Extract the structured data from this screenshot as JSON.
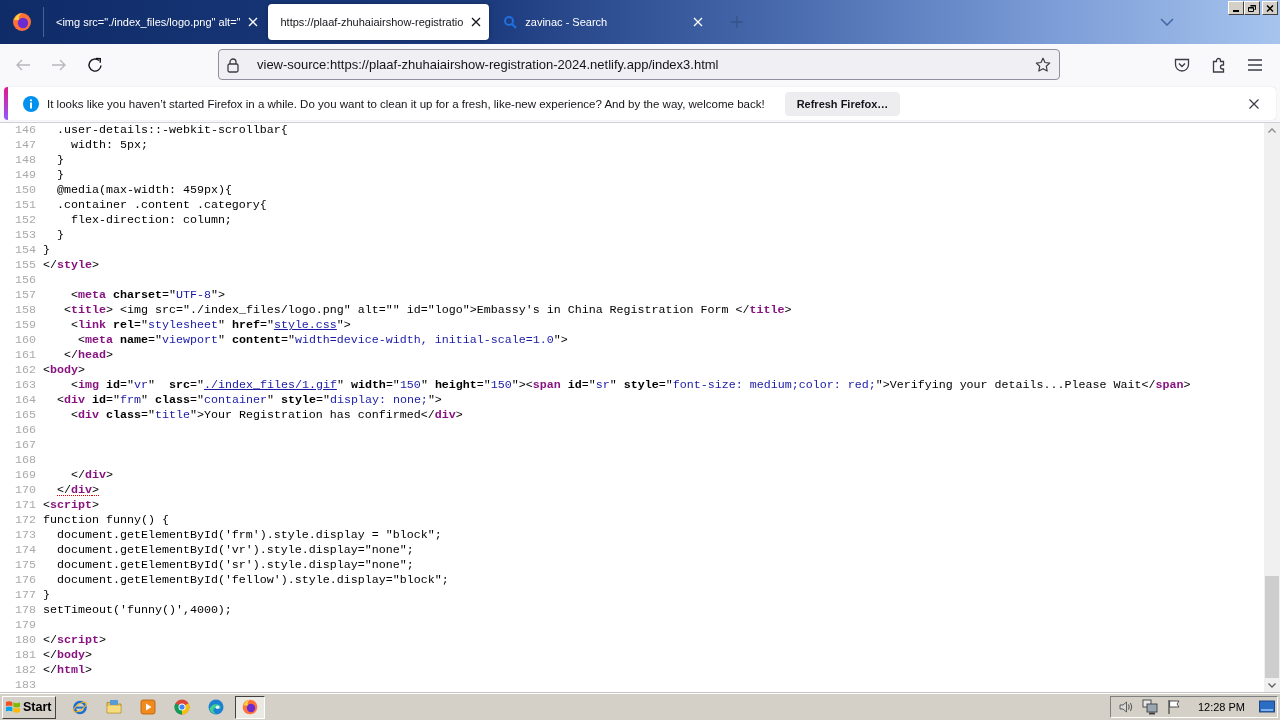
{
  "browser": {
    "tabs": [
      {
        "title": "<img src=\"./index_files/logo.png\" alt=\"",
        "kind": "plain",
        "selected": false
      },
      {
        "title": "https://plaaf-zhuhaiairshow-registratio",
        "kind": "plain",
        "selected": true
      },
      {
        "title": "zavinac - Search",
        "kind": "search",
        "selected": false
      }
    ],
    "nav_buttons": [
      {
        "kind": "back",
        "disabled": true
      },
      {
        "kind": "forward",
        "disabled": true
      },
      {
        "kind": "reload",
        "disabled": false
      }
    ],
    "address_bar": {
      "value": "view-source:https://plaaf-zhuhaiairshow-registration-2024.netlify.app/index3.html"
    },
    "notification": {
      "message": "It looks like you haven’t started Firefox in a while. Do you want to clean it up for a fresh, like-new experience? And by the way, welcome back!",
      "button": "Refresh Firefox…"
    }
  },
  "source": {
    "lines": [
      {
        "number": "146",
        "flagged": false,
        "tokens": [
          {
            "kind": "text",
            "text": "  .user-details::-webkit-scrollbar{"
          }
        ]
      },
      {
        "number": "147",
        "flagged": false,
        "tokens": [
          {
            "kind": "text",
            "text": "    width: 5px;"
          }
        ]
      },
      {
        "number": "148",
        "flagged": false,
        "tokens": [
          {
            "kind": "text",
            "text": "  }"
          }
        ]
      },
      {
        "number": "149",
        "flagged": false,
        "tokens": [
          {
            "kind": "text",
            "text": "  }"
          }
        ]
      },
      {
        "number": "150",
        "flagged": false,
        "tokens": [
          {
            "kind": "text",
            "text": "  @media(max-width: 459px){"
          }
        ]
      },
      {
        "number": "151",
        "flagged": false,
        "tokens": [
          {
            "kind": "text",
            "text": "  .container .content .category{"
          }
        ]
      },
      {
        "number": "152",
        "flagged": false,
        "tokens": [
          {
            "kind": "text",
            "text": "    flex-direction: column;"
          }
        ]
      },
      {
        "number": "153",
        "flagged": false,
        "tokens": [
          {
            "kind": "text",
            "text": "  }"
          }
        ]
      },
      {
        "number": "154",
        "flagged": false,
        "tokens": [
          {
            "kind": "text",
            "text": "}"
          }
        ]
      },
      {
        "number": "155",
        "flagged": false,
        "tokens": [
          {
            "kind": "text",
            "text": "</"
          },
          {
            "kind": "tag",
            "text": "style"
          },
          {
            "kind": "text",
            "text": ">"
          }
        ]
      },
      {
        "number": "156",
        "flagged": false
      },
      {
        "number": "157",
        "flagged": false,
        "tokens": [
          {
            "kind": "text",
            "text": "    <"
          },
          {
            "kind": "tag",
            "text": "meta"
          },
          {
            "kind": "attr",
            "text": " charset"
          },
          {
            "kind": "text",
            "text": "=\""
          },
          {
            "kind": "value",
            "text": "UTF-8"
          },
          {
            "kind": "text",
            "text": "\">"
          }
        ]
      },
      {
        "number": "158",
        "flagged": false,
        "tokens": [
          {
            "kind": "text",
            "text": "   <"
          },
          {
            "kind": "tag",
            "text": "title"
          },
          {
            "kind": "text",
            "text": "> <img src=\"./index_files/logo.png\" alt=\"\" id=\"logo\">Embassy's in China Registration Form </"
          },
          {
            "kind": "tag",
            "text": "title"
          },
          {
            "kind": "text",
            "text": ">"
          }
        ]
      },
      {
        "number": "159",
        "flagged": false,
        "tokens": [
          {
            "kind": "text",
            "text": "    <"
          },
          {
            "kind": "tag",
            "text": "link"
          },
          {
            "kind": "attr",
            "text": " rel"
          },
          {
            "kind": "text",
            "text": "=\""
          },
          {
            "kind": "value",
            "text": "stylesheet"
          },
          {
            "kind": "text",
            "text": "\" "
          },
          {
            "kind": "attr",
            "text": "href"
          },
          {
            "kind": "text",
            "text": "=\""
          },
          {
            "kind": "link",
            "text": "style.css"
          },
          {
            "kind": "text",
            "text": "\">"
          }
        ]
      },
      {
        "number": "160",
        "flagged": false,
        "tokens": [
          {
            "kind": "text",
            "text": "     <"
          },
          {
            "kind": "tag",
            "text": "meta"
          },
          {
            "kind": "attr",
            "text": " name"
          },
          {
            "kind": "text",
            "text": "=\""
          },
          {
            "kind": "value",
            "text": "viewport"
          },
          {
            "kind": "text",
            "text": "\" "
          },
          {
            "kind": "attr",
            "text": "content"
          },
          {
            "kind": "text",
            "text": "=\""
          },
          {
            "kind": "value",
            "text": "width=device-width, initial-scale=1.0"
          },
          {
            "kind": "text",
            "text": "\">"
          }
        ]
      },
      {
        "number": "161",
        "flagged": false,
        "tokens": [
          {
            "kind": "text",
            "text": "   </"
          },
          {
            "kind": "tag",
            "text": "head"
          },
          {
            "kind": "text",
            "text": ">"
          }
        ]
      },
      {
        "number": "162",
        "flagged": false,
        "tokens": [
          {
            "kind": "text",
            "text": "<"
          },
          {
            "kind": "tag",
            "text": "body"
          },
          {
            "kind": "text",
            "text": ">"
          }
        ]
      },
      {
        "number": "163",
        "flagged": false,
        "tokens": [
          {
            "kind": "text",
            "text": "    <"
          },
          {
            "kind": "tag",
            "text": "img"
          },
          {
            "kind": "attr",
            "text": " id"
          },
          {
            "kind": "text",
            "text": "=\""
          },
          {
            "kind": "value",
            "text": "vr"
          },
          {
            "kind": "text",
            "text": "\"  "
          },
          {
            "kind": "attr",
            "text": "src"
          },
          {
            "kind": "text",
            "text": "=\""
          },
          {
            "kind": "link",
            "text": "./index_files/1.gif"
          },
          {
            "kind": "text",
            "text": "\" "
          },
          {
            "kind": "attr",
            "text": "width"
          },
          {
            "kind": "text",
            "text": "=\""
          },
          {
            "kind": "value",
            "text": "150"
          },
          {
            "kind": "text",
            "text": "\" "
          },
          {
            "kind": "attr",
            "text": "height"
          },
          {
            "kind": "text",
            "text": "=\""
          },
          {
            "kind": "value",
            "text": "150"
          },
          {
            "kind": "text",
            "text": "\"><"
          },
          {
            "kind": "tag",
            "text": "span"
          },
          {
            "kind": "attr",
            "text": " id"
          },
          {
            "kind": "text",
            "text": "=\""
          },
          {
            "kind": "value",
            "text": "sr"
          },
          {
            "kind": "text",
            "text": "\" "
          },
          {
            "kind": "attr",
            "text": "style"
          },
          {
            "kind": "text",
            "text": "=\""
          },
          {
            "kind": "value",
            "text": "font-size: medium;color: red;"
          },
          {
            "kind": "text",
            "text": "\">Verifying your details...Please Wait</"
          },
          {
            "kind": "tag",
            "text": "span"
          },
          {
            "kind": "text",
            "text": ">"
          }
        ]
      },
      {
        "number": "164",
        "flagged": false,
        "tokens": [
          {
            "kind": "text",
            "text": "  <"
          },
          {
            "kind": "tag",
            "text": "div"
          },
          {
            "kind": "attr",
            "text": " id"
          },
          {
            "kind": "text",
            "text": "=\""
          },
          {
            "kind": "value",
            "text": "frm"
          },
          {
            "kind": "text",
            "text": "\" "
          },
          {
            "kind": "attr",
            "text": "class"
          },
          {
            "kind": "text",
            "text": "=\""
          },
          {
            "kind": "value",
            "text": "container"
          },
          {
            "kind": "text",
            "text": "\" "
          },
          {
            "kind": "attr",
            "text": "style"
          },
          {
            "kind": "text",
            "text": "=\""
          },
          {
            "kind": "value",
            "text": "display: none;"
          },
          {
            "kind": "text",
            "text": "\">"
          }
        ]
      },
      {
        "number": "165",
        "flagged": false,
        "tokens": [
          {
            "kind": "text",
            "text": "    <"
          },
          {
            "kind": "tag",
            "text": "div"
          },
          {
            "kind": "attr",
            "text": " class"
          },
          {
            "kind": "text",
            "text": "=\""
          },
          {
            "kind": "value",
            "text": "title"
          },
          {
            "kind": "text",
            "text": "\">Your Registration has confirmed</"
          },
          {
            "kind": "tag",
            "text": "div"
          },
          {
            "kind": "text",
            "text": ">"
          }
        ]
      },
      {
        "number": "166",
        "flagged": false
      },
      {
        "number": "167",
        "flagged": false
      },
      {
        "number": "168",
        "flagged": false
      },
      {
        "number": "169",
        "flagged": false,
        "tokens": [
          {
            "kind": "text",
            "text": "    </"
          },
          {
            "kind": "tag",
            "text": "div"
          },
          {
            "kind": "text",
            "text": ">"
          }
        ]
      },
      {
        "number": "170",
        "flagged": true,
        "tokens": [
          {
            "kind": "text",
            "text": "  </"
          },
          {
            "kind": "tag",
            "text": "div"
          },
          {
            "kind": "text",
            "text": ">"
          }
        ]
      },
      {
        "number": "171",
        "flagged": false,
        "tokens": [
          {
            "kind": "text",
            "text": "<"
          },
          {
            "kind": "tag",
            "text": "script"
          },
          {
            "kind": "text",
            "text": ">"
          }
        ]
      },
      {
        "number": "172",
        "flagged": false,
        "tokens": [
          {
            "kind": "text",
            "text": "function funny() {"
          }
        ]
      },
      {
        "number": "173",
        "flagged": false,
        "tokens": [
          {
            "kind": "text",
            "text": "  document.getElementById('frm').style.display = \"block\";"
          }
        ]
      },
      {
        "number": "174",
        "flagged": false,
        "tokens": [
          {
            "kind": "text",
            "text": "  document.getElementById('vr').style.display=\"none\";"
          }
        ]
      },
      {
        "number": "175",
        "flagged": false,
        "tokens": [
          {
            "kind": "text",
            "text": "  document.getElementById('sr').style.display=\"none\";"
          }
        ]
      },
      {
        "number": "176",
        "flagged": false,
        "tokens": [
          {
            "kind": "text",
            "text": "  document.getElementById('fellow').style.display=\"block\";"
          }
        ]
      },
      {
        "number": "177",
        "flagged": false,
        "tokens": [
          {
            "kind": "text",
            "text": "}"
          }
        ]
      },
      {
        "number": "178",
        "flagged": false,
        "tokens": [
          {
            "kind": "text",
            "text": "setTimeout('funny()',4000);"
          }
        ]
      },
      {
        "number": "179",
        "flagged": false
      },
      {
        "number": "180",
        "flagged": false,
        "tokens": [
          {
            "kind": "text",
            "text": "</"
          },
          {
            "kind": "tag",
            "text": "script"
          },
          {
            "kind": "text",
            "text": ">"
          }
        ]
      },
      {
        "number": "181",
        "flagged": false,
        "tokens": [
          {
            "kind": "text",
            "text": "</"
          },
          {
            "kind": "tag",
            "text": "body"
          },
          {
            "kind": "text",
            "text": ">"
          }
        ]
      },
      {
        "number": "182",
        "flagged": false,
        "tokens": [
          {
            "kind": "text",
            "text": "</"
          },
          {
            "kind": "tag",
            "text": "html"
          },
          {
            "kind": "text",
            "text": ">"
          }
        ]
      },
      {
        "number": "183",
        "flagged": false
      }
    ]
  },
  "taskbar": {
    "start": "Start",
    "apps": [
      {
        "kind": "e_globe",
        "selected": false
      },
      {
        "kind": "folder",
        "selected": false
      },
      {
        "kind": "play",
        "selected": false
      },
      {
        "kind": "segmented_circle",
        "selected": false
      },
      {
        "kind": "swirl",
        "selected": false
      },
      {
        "kind": "flame_globe",
        "selected": true
      }
    ],
    "clock": "12:28 PM"
  }
}
